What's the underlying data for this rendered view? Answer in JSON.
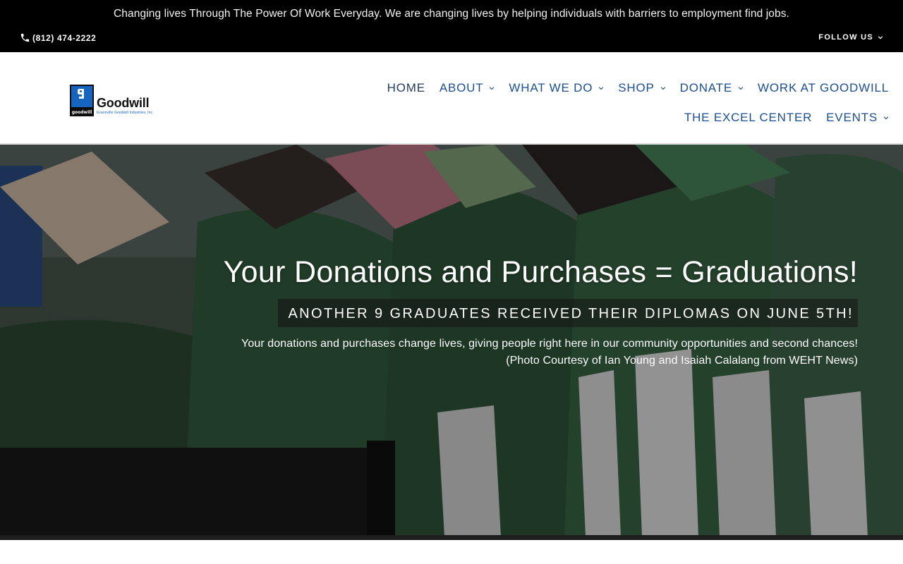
{
  "topbar": {
    "announcement": "Changing lives Through The Power Of Work Everyday. We are changing lives by helping individuals with barriers to employment find jobs.",
    "phone": "(812) 474-2222",
    "follow_label": "FOLLOW US"
  },
  "logo": {
    "name": "Goodwill",
    "mark_text": "goodwill",
    "subtitle": "Evansville Goodwill Industries, Inc."
  },
  "nav": {
    "row1": [
      {
        "label": "HOME",
        "dropdown": false
      },
      {
        "label": "ABOUT",
        "dropdown": true
      },
      {
        "label": "WHAT WE DO",
        "dropdown": true
      },
      {
        "label": "SHOP",
        "dropdown": true
      },
      {
        "label": "DONATE",
        "dropdown": true
      },
      {
        "label": "WORK AT GOODWILL",
        "dropdown": false
      }
    ],
    "row2": [
      {
        "label": "THE EXCEL CENTER",
        "dropdown": false
      },
      {
        "label": "EVENTS",
        "dropdown": true
      }
    ]
  },
  "hero": {
    "title": "Your Donations and Purchases = Graduations!",
    "subtitle": "ANOTHER 9 GRADUATES RECEIVED THEIR DIPLOMAS ON JUNE 5TH!",
    "line1": "Your donations and purchases change lives, giving people right here in our community opportunities and second chances!",
    "line2": "(Photo Courtesy of Ian Young and Isaiah Calalang from WEHT News)"
  },
  "colors": {
    "topbar_bg": "#000000",
    "nav_text": "#1b4f94",
    "brand_blue": "#1565c0",
    "gown_green": "#2f5e3c"
  }
}
